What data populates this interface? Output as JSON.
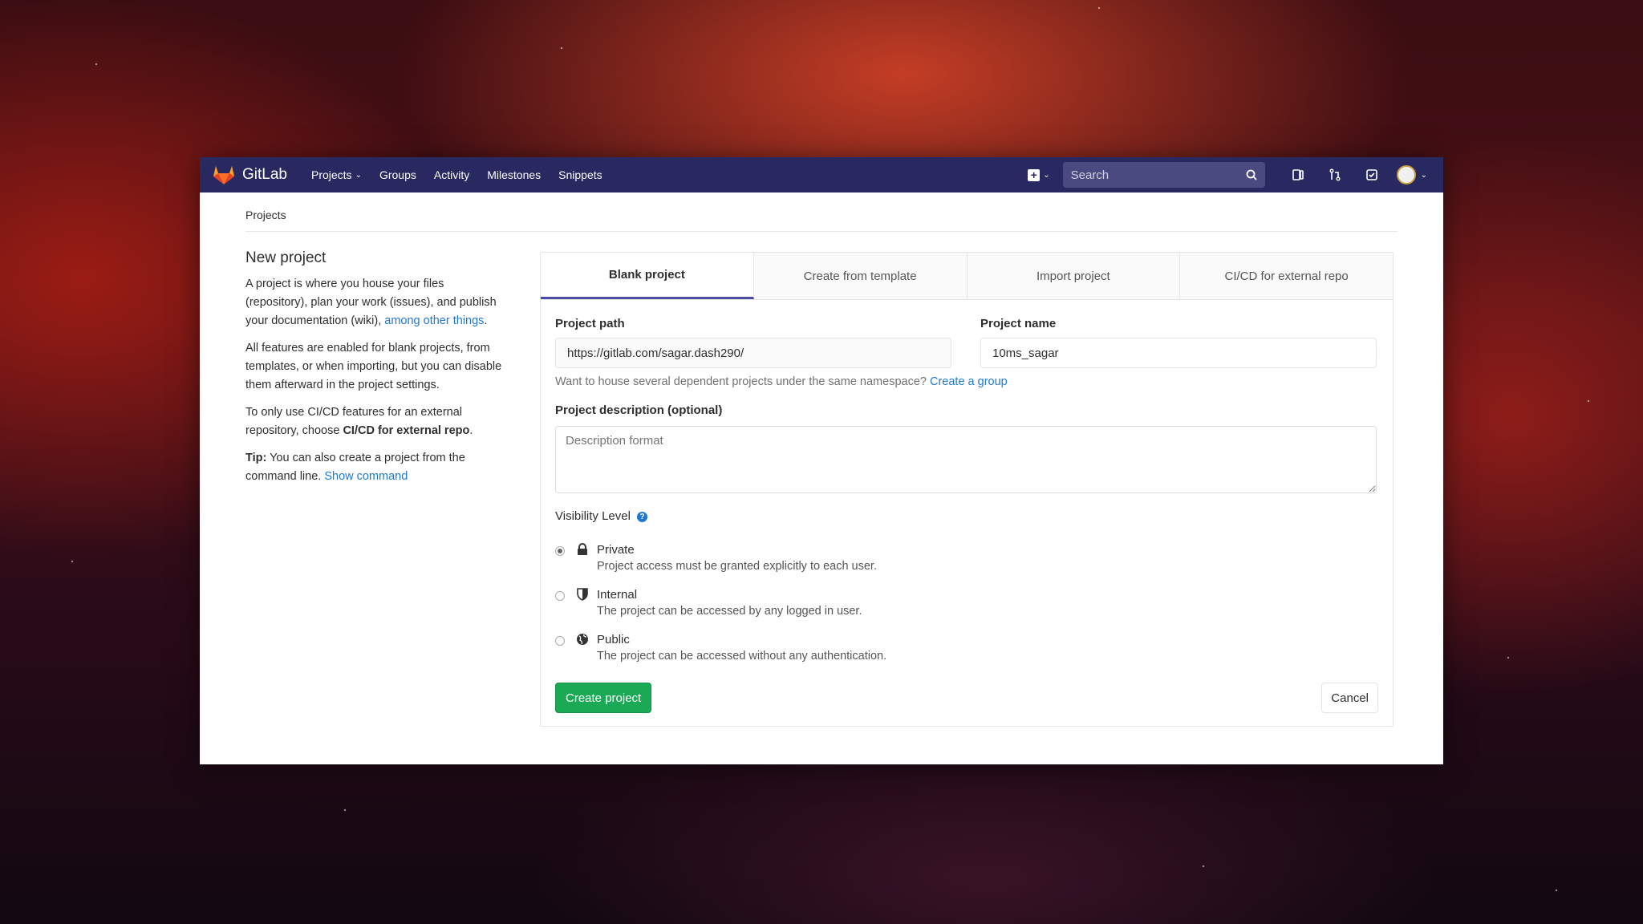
{
  "app": {
    "brand": "GitLab",
    "nav": [
      "Projects",
      "Groups",
      "Activity",
      "Milestones",
      "Snippets"
    ],
    "search_placeholder": "Search"
  },
  "breadcrumb": "Projects",
  "sidebar": {
    "title": "New project",
    "p1_text": "A project is where you house your files (repository), plan your work (issues), and publish your documentation (wiki),",
    "p1_link": "among other things",
    "p2": "All features are enabled for blank projects, from templates, or when importing, but you can disable them afterward in the project settings.",
    "p3_text": "To only use CI/CD features for an external repository, choose",
    "p3_bold": "CI/CD for external repo",
    "tip_label": "Tip:",
    "tip_text": "You can also create a project from the command line.",
    "tip_link": "Show command"
  },
  "tabs": [
    "Blank project",
    "Create from template",
    "Import project",
    "CI/CD for external repo"
  ],
  "form": {
    "path_label": "Project path",
    "path_value": "https://gitlab.com/sagar.dash290/",
    "name_label": "Project name",
    "name_value": "10ms_sagar",
    "namespace_hint": "Want to house several dependent projects under the same namespace?",
    "namespace_link": "Create a group",
    "desc_label": "Project description (optional)",
    "desc_placeholder": "Description format",
    "visibility_label": "Visibility Level",
    "visibility": [
      {
        "title": "Private",
        "desc": "Project access must be granted explicitly to each user.",
        "checked": true
      },
      {
        "title": "Internal",
        "desc": "The project can be accessed by any logged in user.",
        "checked": false
      },
      {
        "title": "Public",
        "desc": "The project can be accessed without any authentication.",
        "checked": false
      }
    ],
    "create_label": "Create project",
    "cancel_label": "Cancel"
  }
}
